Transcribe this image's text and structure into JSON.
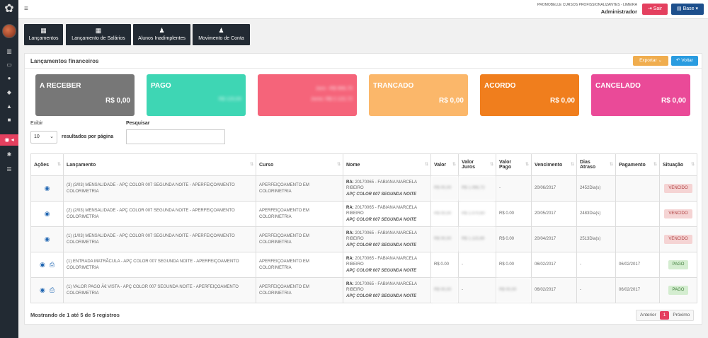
{
  "topbar": {
    "org": "PROMOBELLE CURSOS PROFISSIONALIZANTES - LIMEIRA",
    "user": "Administrador",
    "sair_label": "Sair",
    "base_label": "Base"
  },
  "shortcuts": [
    {
      "label": "Lançamentos",
      "icon": "calculator-icon"
    },
    {
      "label": "Lançamento de Salários",
      "icon": "calculator-icon"
    },
    {
      "label": "Alunos Inadimplentes",
      "icon": "user-icon"
    },
    {
      "label": "Movimento de Conta",
      "icon": "user-icon"
    }
  ],
  "panel": {
    "title": "Lançamentos financeiros",
    "export_label": "Exportar",
    "back_label": "Voltar"
  },
  "cards": [
    {
      "title": "A RECEBER",
      "value": "R$ 0,00",
      "color": "#777777"
    },
    {
      "title": "PAGO",
      "value": "R$ 120,00",
      "color": "#3ed6b4"
    },
    {
      "title": "",
      "value_a": "Juro: -R$ 906,70",
      "value_b": "Juros: R$ 2.122,72",
      "color": "#f5647a"
    },
    {
      "title": "TRANCADO",
      "value": "R$ 0,00",
      "color": "#fbb76a"
    },
    {
      "title": "ACORDO",
      "value": "R$ 0,00",
      "color": "#f07e1d"
    },
    {
      "title": "CANCELADO",
      "value": "R$ 0,00",
      "color": "#ea4a98"
    }
  ],
  "controls": {
    "exibir": "Exibir",
    "page_size": "10",
    "per_page": "resultados por página",
    "search_label": "Pesquisar"
  },
  "table": {
    "headers": {
      "acoes": "Ações",
      "lancamento": "Lançamento",
      "curso": "Curso",
      "nome": "Nome",
      "valor": "Valor",
      "juros_1": "Valor",
      "juros_2": "Juros",
      "pago_1": "Valor",
      "pago_2": "Pago",
      "vencimento": "Vencimento",
      "dias_1": "Dias",
      "dias_2": "Atraso",
      "pagamento": "Pagamento",
      "situacao": "Situação"
    },
    "rows": [
      {
        "lancamento": "(3) (3/03) MENSALIDADE - APÇ COLOR 007 SEGUNDA NOITE - APERFEIÇOAMENTO COLORIMETRIA",
        "curso": "APERFEIÇOAMENTO EM COLORIMETRIA",
        "ra_label": "RA:",
        "ra": "20170065 - FABIANA MARCELA RIBEIRO",
        "turma": "APÇ COLOR 007 SEGUNDA NOITE",
        "valor": "R$ 00,00",
        "juros": "R$ 1.066,72",
        "pago": "-",
        "vencimento": "20/06/2017",
        "dias": "2452Dia(s)",
        "pagamento": "",
        "situacao": "VENCIDO"
      },
      {
        "lancamento": "(2) (2/03) MENSALIDADE - APÇ COLOR 007 SEGUNDA NOITE - APERFEIÇOAMENTO COLORIMETRIA",
        "curso": "APERFEIÇOAMENTO EM COLORIMETRIA",
        "ra_label": "RA:",
        "ra": "20170065 - FABIANA MARCELA RIBEIRO",
        "turma": "APÇ COLOR 007 SEGUNDA NOITE",
        "valor": "R$ 00,00",
        "juros": "R$ 1.070,60",
        "pago": "R$ 0.00",
        "vencimento": "20/05/2017",
        "dias": "2483Dia(s)",
        "pagamento": "",
        "situacao": "VENCIDO"
      },
      {
        "lancamento": "(1) (1/03) MENSALIDADE - APÇ COLOR 007 SEGUNDA NOITE - APERFEIÇOAMENTO COLORIMETRIA",
        "curso": "APERFEIÇOAMENTO EM COLORIMETRIA",
        "ra_label": "RA:",
        "ra": "20170065 - FABIANA MARCELA RIBEIRO",
        "turma": "APÇ COLOR 007 SEGUNDA NOITE",
        "valor": "R$ 00,00",
        "juros": "R$ 1.115,69",
        "pago": "R$ 0.00",
        "vencimento": "20/04/2017",
        "dias": "2513Dia(s)",
        "pagamento": "",
        "situacao": "VENCIDO"
      },
      {
        "lancamento": "(1) ENTRADA MATRÃCULA - APÇ COLOR 007 SEGUNDA NOITE - APERFEIÇOAMENTO COLORIMETRIA",
        "curso": "APERFEIÇOAMENTO EM COLORIMETRIA",
        "ra_label": "RA:",
        "ra": "20170065 - FABIANA MARCELA RIBEIRO",
        "turma": "APÇ COLOR 007 SEGUNDA NOITE",
        "valor": "R$ 0.00",
        "juros": "-",
        "pago": "R$ 0.00",
        "vencimento": "06/02/2017",
        "dias": "-",
        "pagamento": "06/02/2017",
        "situacao": "PAGO"
      },
      {
        "lancamento": "(1) VALOR PAGO Ã€ VISTA - APÇ COLOR 007 SEGUNDA NOITE - APERFEIÇOAMENTO COLORIMETRIA",
        "curso": "APERFEIÇOAMENTO EM COLORIMETRIA",
        "ra_label": "RA:",
        "ra": "20170065 - FABIANA MARCELA RIBEIRO",
        "turma": "APÇ COLOR 007 SEGUNDA NOITE",
        "valor": "R$ 00,00",
        "juros": "-",
        "pago": "R$ 00,00",
        "vencimento": "06/02/2017",
        "dias": "-",
        "pagamento": "06/02/2017",
        "situacao": "PAGO"
      }
    ]
  },
  "footer": {
    "info": "Mostrando de 1 até 5 de 5 registros",
    "prev": "Anterior",
    "page": "1",
    "next": "Próximo"
  }
}
